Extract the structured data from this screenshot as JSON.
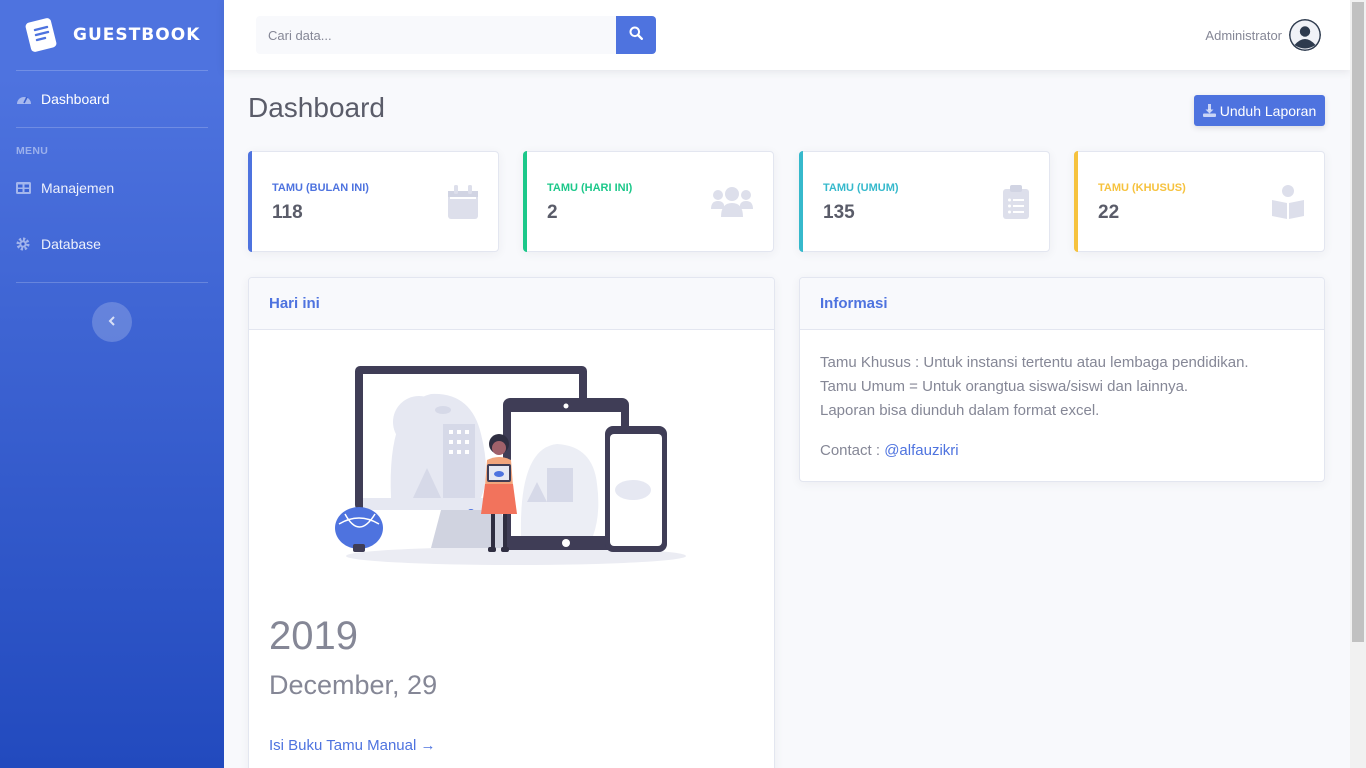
{
  "app": {
    "brand": "GUESTBOOK"
  },
  "sidebar": {
    "dashboard_label": "Dashboard",
    "heading": "MENU",
    "items": [
      {
        "label": "Manajemen",
        "icon": "table-icon"
      },
      {
        "label": "Database",
        "icon": "gear-icon"
      }
    ]
  },
  "topbar": {
    "search_placeholder": "Cari data...",
    "user_name": "Administrator"
  },
  "page": {
    "title": "Dashboard",
    "download_label": "Unduh Laporan"
  },
  "stats": [
    {
      "label": "TAMU (BULAN INI)",
      "value": "118",
      "color": "#4e73df",
      "icon": "calendar-icon"
    },
    {
      "label": "TAMU (HARI INI)",
      "value": "2",
      "color": "#1cc88a",
      "icon": "users-icon"
    },
    {
      "label": "TAMU (UMUM)",
      "value": "135",
      "color": "#36b9cc",
      "icon": "clipboard-icon"
    },
    {
      "label": "TAMU (KHUSUS)",
      "value": "22",
      "color": "#f6c23e",
      "icon": "book-reader-icon"
    }
  ],
  "today_card": {
    "title": "Hari ini",
    "year": "2019",
    "date": "December, 29",
    "link": "Isi Buku Tamu Manual →"
  },
  "info_card": {
    "title": "Informasi",
    "lines": [
      "Tamu Khusus : Untuk instansi tertentu atau lembaga pendidikan.",
      "Tamu Umum = Untuk orangtua siswa/siswi dan lainnya.",
      "Laporan bisa diunduh dalam format excel."
    ],
    "contact_label": "Contact :",
    "contact_handle": "@alfauzikri"
  }
}
